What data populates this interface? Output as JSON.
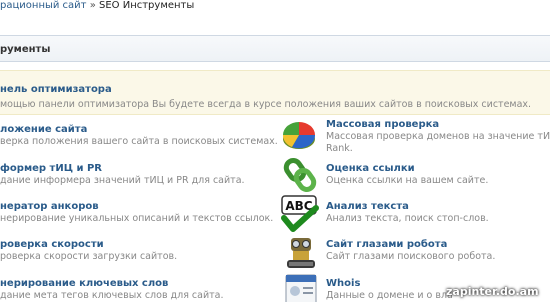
{
  "breadcrumb": {
    "parent": "рационный сайт",
    "separator": "»",
    "current": "SEO Инструменты"
  },
  "section_title": "рументы",
  "banner": {
    "title": "нель оптимизатора",
    "description": "мощью панели оптимизатора Вы будете всегда в курсе положения ваших сайтов в поисковых системах."
  },
  "left_items": [
    {
      "title": "ложение сайта",
      "description": "верка положения вашего сайта в поисковых системах."
    },
    {
      "title": "формер тИЦ и PR",
      "description": "дание информера значений тИЦ и PR для сайта."
    },
    {
      "title": "нератор анкоров",
      "description": "нерирование уникальных описаний и текстов ссылок."
    },
    {
      "title": "роверка скорости",
      "description": "роверка скорости загрузки сайтов."
    },
    {
      "title": "нерирование ключевых слов",
      "description": "дание мета тегов ключевых слов для сайта."
    }
  ],
  "right_items": [
    {
      "title": "Массовая проверка",
      "description": "Массовая проверка доменов на значение тИЦ и",
      "description2": "Rank.",
      "icon": "pie-chart-icon"
    },
    {
      "title": "Оценка ссылки",
      "description": "Оценка ссылки на вашем сайте.",
      "icon": "chain-link-icon"
    },
    {
      "title": "Анализ текста",
      "description": "Анализ текста, поиск стоп-слов.",
      "icon": "abc-check-icon",
      "icon_text": "ABC"
    },
    {
      "title": "Сайт глазами робота",
      "description": "Сайт глазами поискового робота.",
      "icon": "robot-icon"
    },
    {
      "title": "Whois",
      "description": "Данные о домене и о вла",
      "icon": "id-card-icon"
    }
  ],
  "watermark": "zapinter.do.am"
}
